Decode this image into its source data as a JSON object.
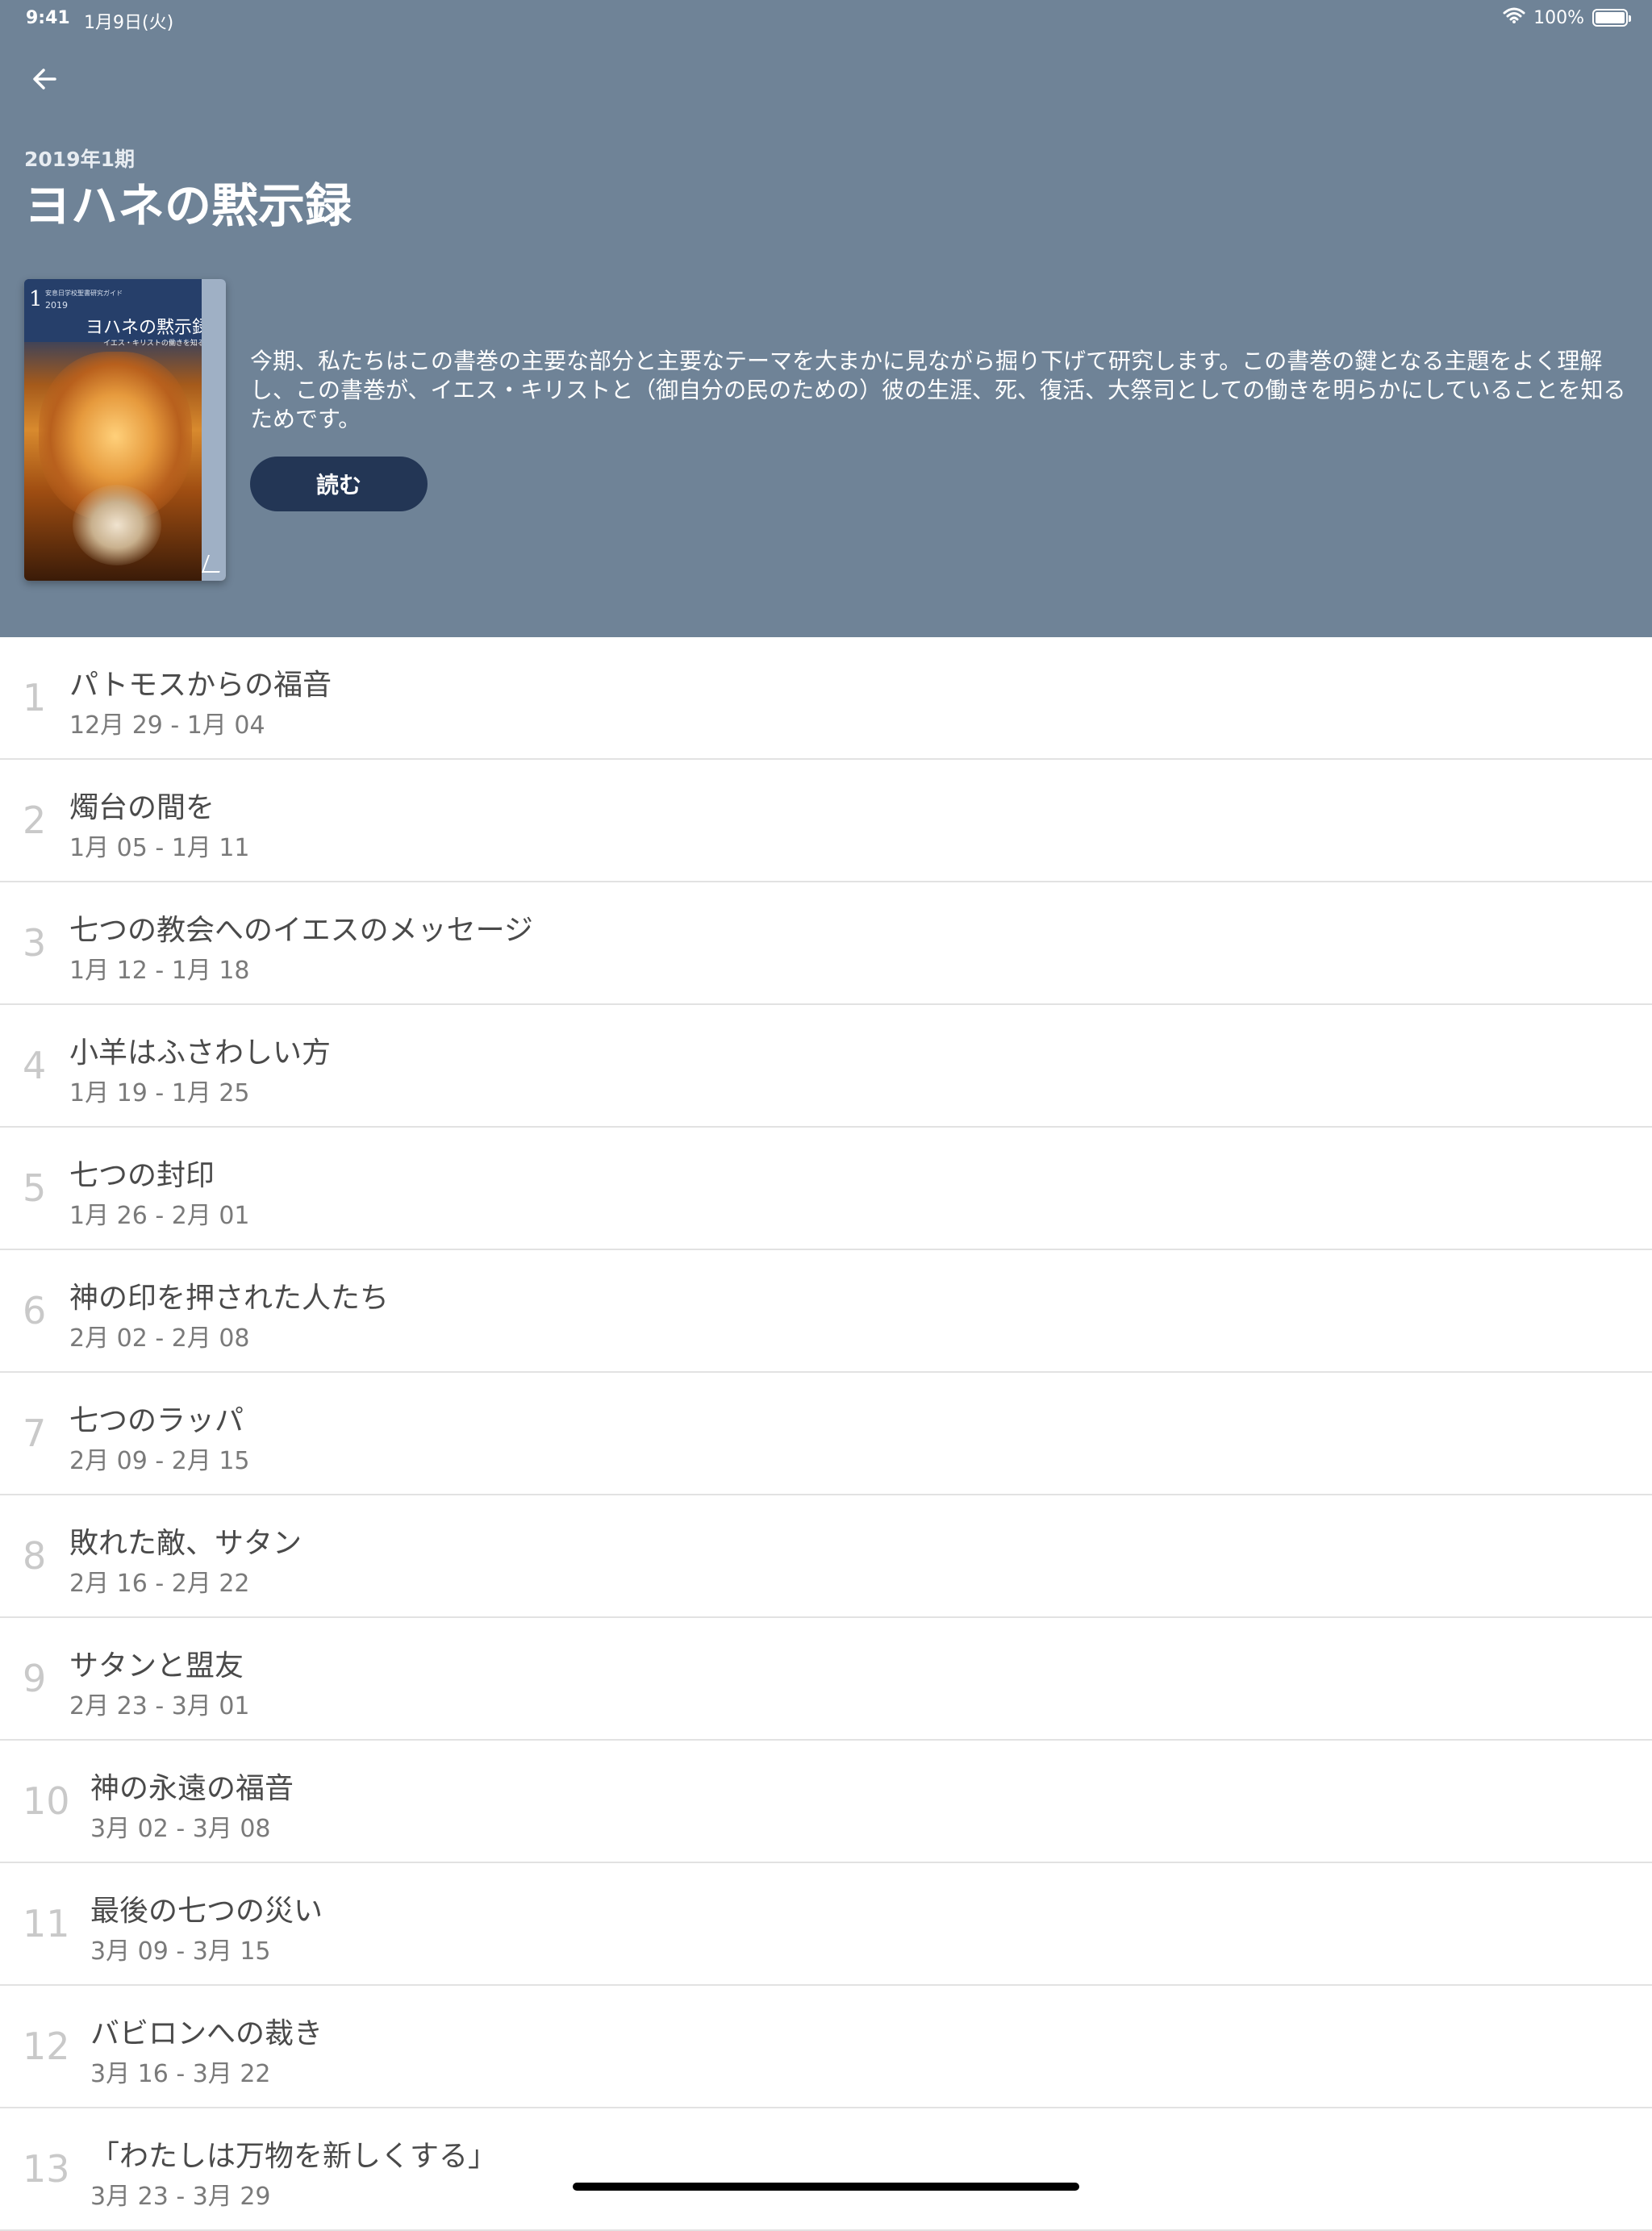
{
  "status_bar": {
    "time": "9:41",
    "date": "1月9日(火)",
    "battery": "100%"
  },
  "header": {
    "quarter": "2019年1期",
    "title": "ヨハネの黙示録",
    "description": "今期、私たちはこの書巻の主要な部分と主要なテーマを大まかに見ながら掘り下げて研究します。この書巻の鍵となる主題をよく理解し、この書巻が、イエス・キリストと（御自分の民のための）彼の生涯、死、復活、大祭司としての働きを明らかにしていることを知るためです。",
    "read_button": "読む",
    "background_color": "#6f8397",
    "button_color": "#233655"
  },
  "cover": {
    "number": "1",
    "small_text": "安息日学校聖書研究ガイド",
    "year": "2019",
    "title": "ヨハネの黙示録",
    "subtitle": "イエス・キリストの働きを知る"
  },
  "lessons": [
    {
      "number": "1",
      "title": "パトモスからの福音",
      "date": "12月 29 - 1月 04"
    },
    {
      "number": "2",
      "title": "燭台の間を",
      "date": "1月 05 - 1月 11"
    },
    {
      "number": "3",
      "title": "七つの教会へのイエスのメッセージ",
      "date": "1月 12 - 1月 18"
    },
    {
      "number": "4",
      "title": "小羊はふさわしい方",
      "date": "1月 19 - 1月 25"
    },
    {
      "number": "5",
      "title": "七つの封印",
      "date": "1月 26 - 2月 01"
    },
    {
      "number": "6",
      "title": "神の印を押された人たち",
      "date": "2月 02 - 2月 08"
    },
    {
      "number": "7",
      "title": "七つのラッパ",
      "date": "2月 09 - 2月 15"
    },
    {
      "number": "8",
      "title": "敗れた敵、サタン",
      "date": "2月 16 - 2月 22"
    },
    {
      "number": "9",
      "title": "サタンと盟友",
      "date": "2月 23 - 3月 01"
    },
    {
      "number": "10",
      "title": "神の永遠の福音",
      "date": "3月 02 - 3月 08"
    },
    {
      "number": "11",
      "title": "最後の七つの災い",
      "date": "3月 09 - 3月 15"
    },
    {
      "number": "12",
      "title": "バビロンへの裁き",
      "date": "3月 16 - 3月 22"
    },
    {
      "number": "13",
      "title": "「わたしは万物を新しくする」",
      "date": "3月 23 - 3月 29"
    }
  ]
}
